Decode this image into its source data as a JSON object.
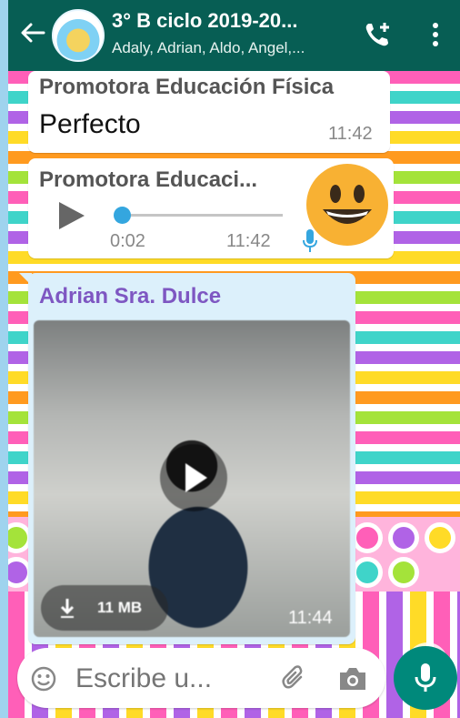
{
  "header": {
    "title": "3° B ciclo 2019-20...",
    "subtitle": "Adaly, Adrian, Aldo, Angel,...",
    "icons": {
      "back": "back-arrow-icon",
      "call": "add-call-icon",
      "menu": "more-vert-icon"
    }
  },
  "messages": [
    {
      "sender": "Promotora Educación Física",
      "text": "Perfecto",
      "time": "11:42"
    },
    {
      "sender": "Promotora Educaci...",
      "voice_duration": "0:02",
      "time": "11:42",
      "progress": 0.0
    },
    {
      "sender": "Adrian Sra. Dulce",
      "video_size": "11 MB",
      "time": "11:44"
    }
  ],
  "input": {
    "placeholder": "Escribe u..."
  },
  "colors": {
    "header": "#075e54",
    "accent": "#00897b",
    "sender_video": "#7e57c2"
  }
}
